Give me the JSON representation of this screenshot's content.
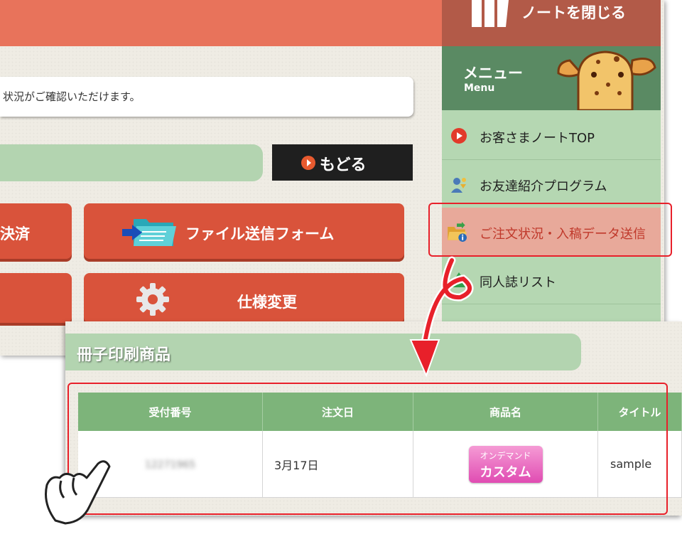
{
  "header": {
    "notice_text": "状況がご確認いただけます。",
    "back_button": "もどる"
  },
  "buttons": {
    "payment": "決済",
    "file_form": "ファイル送信フォーム",
    "spec_change": "仕様変更"
  },
  "sidebar": {
    "close_note": "ノートを閉じる",
    "menu_title": "メニュー",
    "menu_subtitle": "Menu",
    "items": [
      {
        "label": "お客さまノートTOP",
        "icon": "play-circle-icon"
      },
      {
        "label": "お友達紹介プログラム",
        "icon": "friends-icon"
      },
      {
        "label": "ご注文状況・入稿データ送信",
        "icon": "folder-info-icon",
        "highlighted": true
      },
      {
        "label": "同人誌リスト",
        "icon": "tree-icon"
      }
    ]
  },
  "section": {
    "title": "冊子印刷商品"
  },
  "table": {
    "headers": [
      "受付番号",
      "注文日",
      "商品名",
      "タイトル"
    ],
    "rows": [
      {
        "receipt": "12271965",
        "date": "3月17日",
        "product_line1": "オンデマンド",
        "product_line2": "カスタム",
        "title": "sample"
      }
    ]
  },
  "colors": {
    "accent_red": "#e8202a",
    "menu_green": "#b5d7b2",
    "header_orange": "#e8735b",
    "button_red": "#d9533b"
  }
}
